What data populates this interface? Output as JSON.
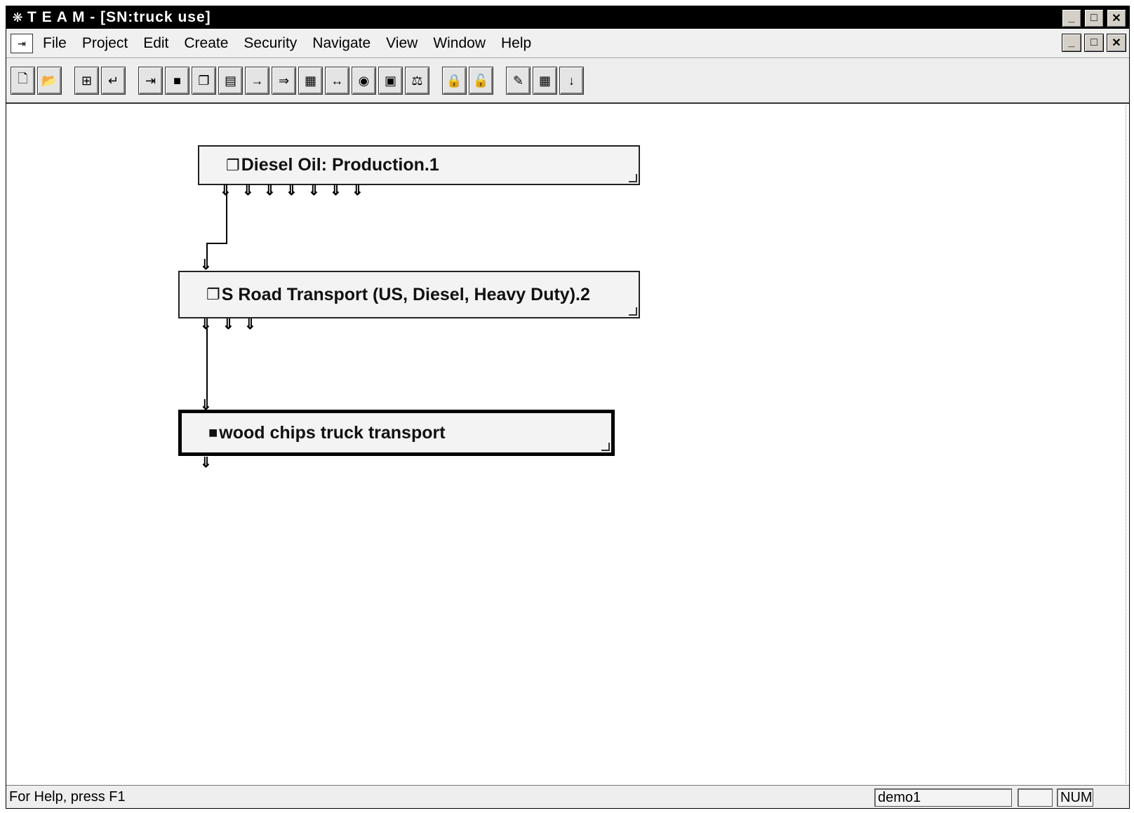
{
  "window": {
    "title": "T E A M - [SN:truck use]",
    "app_icon": "team-app-icon"
  },
  "caption_buttons": {
    "minimize": "_",
    "maximize": "□",
    "close": "✕"
  },
  "menu": {
    "items": [
      "File",
      "Project",
      "Edit",
      "Create",
      "Security",
      "Navigate",
      "View",
      "Window",
      "Help"
    ]
  },
  "toolbar": {
    "groups": [
      [
        "new-file-icon",
        "open-file-icon"
      ],
      [
        "tree-view-icon",
        "return-icon"
      ],
      [
        "module-icon",
        "process-icon",
        "copy-process-icon",
        "multi-process-icon",
        "input-flow-icon",
        "output-flow-icon",
        "block-icon",
        "range-icon",
        "globe-icon",
        "report-icon",
        "balance-icon"
      ],
      [
        "lock-down-icon",
        "lock-up-icon"
      ],
      [
        "edit-table-icon",
        "grid-icon",
        "down-arrow-icon"
      ]
    ]
  },
  "nodes": [
    {
      "label": "Diesel Oil: Production.1",
      "icon": "copy-process-icon"
    },
    {
      "label": "S Road Transport (US, Diesel, Heavy Duty).2",
      "icon": "copy-process-icon"
    },
    {
      "label": "wood chips truck transport",
      "icon": "process-icon"
    }
  ],
  "status": {
    "help_text": "For Help, press F1",
    "user": "demo1",
    "empty_panel": "",
    "num_indicator": "NUM"
  }
}
